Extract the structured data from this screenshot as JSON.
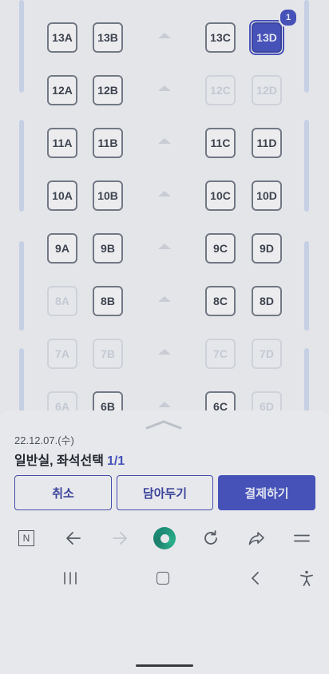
{
  "seat_map": {
    "rows": [
      {
        "seats": [
          {
            "label": "13A",
            "state": "available"
          },
          {
            "label": "13B",
            "state": "available"
          },
          {
            "label": "13C",
            "state": "available"
          },
          {
            "label": "13D",
            "state": "selected",
            "badge": "1"
          }
        ]
      },
      {
        "seats": [
          {
            "label": "12A",
            "state": "available"
          },
          {
            "label": "12B",
            "state": "available"
          },
          {
            "label": "12C",
            "state": "unavailable"
          },
          {
            "label": "12D",
            "state": "unavailable"
          }
        ]
      },
      {
        "seats": [
          {
            "label": "11A",
            "state": "available"
          },
          {
            "label": "11B",
            "state": "available"
          },
          {
            "label": "11C",
            "state": "available"
          },
          {
            "label": "11D",
            "state": "available"
          }
        ]
      },
      {
        "seats": [
          {
            "label": "10A",
            "state": "available"
          },
          {
            "label": "10B",
            "state": "available"
          },
          {
            "label": "10C",
            "state": "available"
          },
          {
            "label": "10D",
            "state": "available"
          }
        ]
      },
      {
        "seats": [
          {
            "label": "9A",
            "state": "available"
          },
          {
            "label": "9B",
            "state": "available"
          },
          {
            "label": "9C",
            "state": "available"
          },
          {
            "label": "9D",
            "state": "available"
          }
        ]
      },
      {
        "seats": [
          {
            "label": "8A",
            "state": "unavailable"
          },
          {
            "label": "8B",
            "state": "available"
          },
          {
            "label": "8C",
            "state": "available"
          },
          {
            "label": "8D",
            "state": "available"
          }
        ]
      },
      {
        "seats": [
          {
            "label": "7A",
            "state": "unavailable"
          },
          {
            "label": "7B",
            "state": "unavailable"
          },
          {
            "label": "7C",
            "state": "unavailable"
          },
          {
            "label": "7D",
            "state": "unavailable"
          }
        ]
      },
      {
        "seats": [
          {
            "label": "6A",
            "state": "unavailable"
          },
          {
            "label": "6B",
            "state": "available"
          },
          {
            "label": "6C",
            "state": "available"
          },
          {
            "label": "6D",
            "state": "unavailable"
          }
        ]
      }
    ]
  },
  "sheet": {
    "date": "22.12.07.(수)",
    "title": "일반실, 좌석선택",
    "selection_count": "1/1",
    "buttons": {
      "cancel": "취소",
      "save": "담아두기",
      "pay": "결제하기"
    }
  },
  "browser_toolbar": {
    "icons": [
      "naver-n-icon",
      "back-arrow-icon",
      "forward-arrow-icon",
      "whale-home-icon",
      "refresh-icon",
      "share-icon",
      "menu-icon"
    ],
    "tab_letter": "N"
  },
  "system_nav": {
    "icons": [
      "recent-apps-icon",
      "home-icon",
      "back-icon",
      "accessibility-icon"
    ]
  },
  "colors": {
    "accent": "#4652b8",
    "seat_border": "#727884",
    "unavailable": "#ced2d9"
  }
}
